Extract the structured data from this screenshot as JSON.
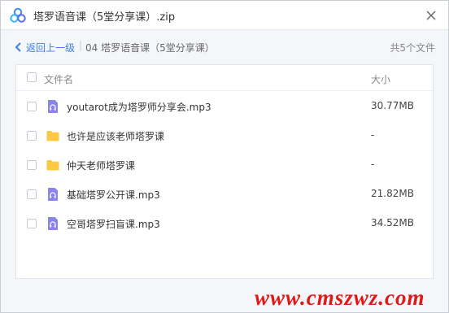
{
  "window": {
    "title": "塔罗语音课（5堂分享课）.zip"
  },
  "nav": {
    "back_label": "返回上一级",
    "separator": "|",
    "current_folder": "04 塔罗语音课（5堂分享课）",
    "file_count": "共5个文件"
  },
  "list": {
    "headers": {
      "name": "文件名",
      "size": "大小"
    },
    "rows": [
      {
        "name": "youtarot成为塔罗师分享会.mp3",
        "size": "30.77MB",
        "type": "audio"
      },
      {
        "name": "也许是应该老师塔罗课",
        "size": "-",
        "type": "folder"
      },
      {
        "name": "仲天老师塔罗课",
        "size": "-",
        "type": "folder"
      },
      {
        "name": "基础塔罗公开课.mp3",
        "size": "21.82MB",
        "type": "audio"
      },
      {
        "name": "空哥塔罗扫盲课.mp3",
        "size": "34.52MB",
        "type": "audio"
      }
    ]
  },
  "watermark": "www.cmszwz.com",
  "colors": {
    "accent": "#3d7fe6",
    "folder": "#ffc842",
    "audio": "#8b83f0",
    "watermark": "#e01818"
  },
  "icons": {
    "audio": "headphones-file-icon",
    "folder": "folder-icon"
  }
}
